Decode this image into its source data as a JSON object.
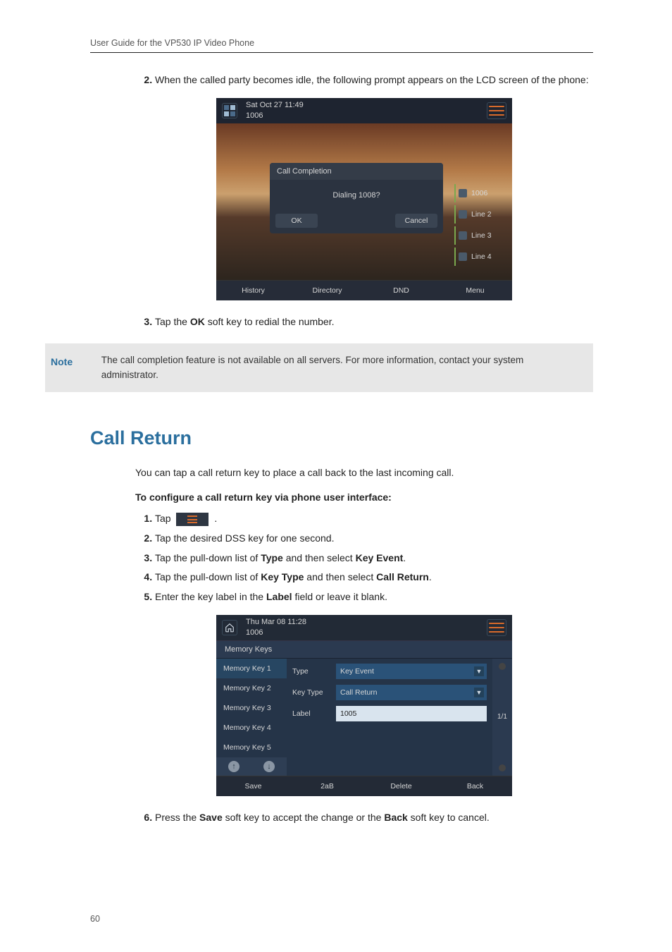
{
  "header": "User Guide for the VP530 IP Video Phone",
  "page_number": "60",
  "step2_text": "When the called party becomes idle, the following prompt appears on the LCD screen of the phone:",
  "screenshot1": {
    "datetime": "Sat Oct 27 11:49",
    "ext": "1006",
    "dialog_title": "Call Completion",
    "dialog_body": "Dialing 1008?",
    "ok": "OK",
    "cancel": "Cancel",
    "lines": [
      "1006",
      "Line 2",
      "Line 3",
      "Line 4"
    ],
    "softkeys": [
      "History",
      "Directory",
      "DND",
      "Menu"
    ]
  },
  "step3_pre": "Tap the ",
  "step3_b": "OK",
  "step3_post": " soft key to redial the number.",
  "note_label": "Note",
  "note_text": "The call completion feature is not available on all servers. For more information, contact your system administrator.",
  "section_title": "Call Return",
  "para1": "You can tap a call return key to place a call back to the last incoming call.",
  "subhead": "To configure a call return key via phone user interface:",
  "r1": "Tap",
  "r1_post": " .",
  "r2": "Tap the desired DSS key for one second.",
  "r3_pre": "Tap the pull-down list of ",
  "r3_b1": "Type",
  "r3_mid": " and then select ",
  "r3_b2": "Key Event",
  "r3_post": ".",
  "r4_pre": "Tap the pull-down list of ",
  "r4_b1": "Key Type",
  "r4_mid": " and then select ",
  "r4_b2": "Call Return",
  "r4_post": ".",
  "r5_pre": "Enter the key label in the ",
  "r5_b": "Label",
  "r5_post": " field or leave it blank.",
  "screenshot2": {
    "datetime": "Thu Mar 08 11:28",
    "ext": "1006",
    "title": "Memory Keys",
    "memkeys": [
      "Memory Key 1",
      "Memory Key 2",
      "Memory Key 3",
      "Memory Key 4",
      "Memory Key 5"
    ],
    "type_lab": "Type",
    "type_val": "Key Event",
    "keytype_lab": "Key Type",
    "keytype_val": "Call Return",
    "label_lab": "Label",
    "label_val": "1005",
    "pager": "1/1",
    "softkeys": [
      "Save",
      "2aB",
      "Delete",
      "Back"
    ]
  },
  "step6_pre": "Press the ",
  "step6_b1": "Save",
  "step6_mid": " soft key to accept the change or the ",
  "step6_b2": "Back",
  "step6_post": " soft key to cancel."
}
